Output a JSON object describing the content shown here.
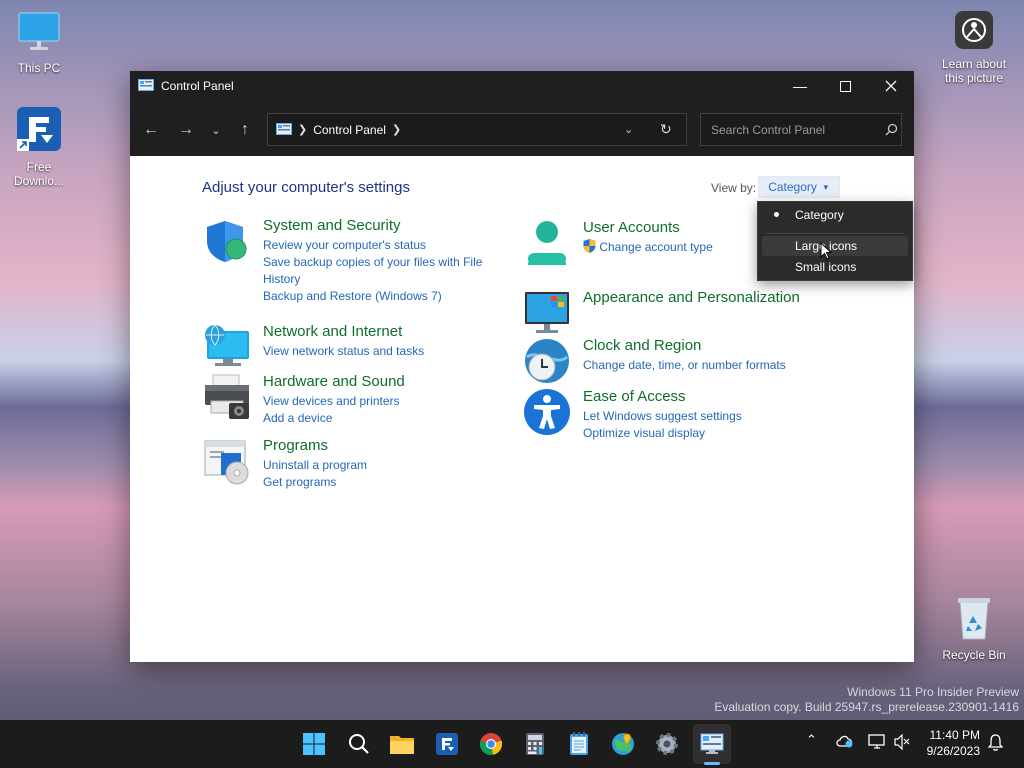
{
  "desktop": {
    "icons": [
      {
        "label": "This PC"
      },
      {
        "label": "Free Downlo..."
      },
      {
        "label": "Learn about this picture"
      },
      {
        "label": "Recycle Bin"
      }
    ],
    "watermark": {
      "line1": "Windows 11 Pro Insider Preview",
      "line2": "Evaluation copy. Build 25947.rs_prerelease.230901-1416"
    }
  },
  "window": {
    "title": "Control Panel",
    "address": {
      "path": "Control Panel"
    },
    "search": {
      "placeholder": "Search Control Panel"
    },
    "heading": "Adjust your computer's settings",
    "view_by": {
      "label": "View by:",
      "value": "Category"
    },
    "menu": {
      "items": [
        "Category",
        "Large icons",
        "Small icons"
      ],
      "selected": "Category",
      "hovered": "Large icons"
    },
    "categories": [
      {
        "title": "System and Security",
        "links": [
          "Review your computer's status",
          "Save backup copies of your files with File History",
          "Backup and Restore (Windows 7)"
        ]
      },
      {
        "title": "Network and Internet",
        "links": [
          "View network status and tasks"
        ]
      },
      {
        "title": "Hardware and Sound",
        "links": [
          "View devices and printers",
          "Add a device"
        ]
      },
      {
        "title": "Programs",
        "links": [
          "Uninstall a program",
          "Get programs"
        ]
      },
      {
        "title": "User Accounts",
        "links": [
          "Change account type"
        ]
      },
      {
        "title": "Appearance and Personalization",
        "links": []
      },
      {
        "title": "Clock and Region",
        "links": [
          "Change date, time, or number formats"
        ]
      },
      {
        "title": "Ease of Access",
        "links": [
          "Let Windows suggest settings",
          "Optimize visual display"
        ]
      }
    ]
  },
  "taskbar": {
    "apps": [
      "start-icon",
      "search-icon",
      "file-explorer-icon",
      "free-download-manager-icon",
      "chrome-icon",
      "calculator-icon",
      "notepad-icon",
      "maps-icon",
      "settings-icon",
      "control-panel-icon"
    ],
    "clock": {
      "time": "11:40 PM",
      "date": "9/26/2023"
    }
  },
  "colors": {
    "category_title": "#0f6e2b",
    "link": "#2468b8",
    "heading": "#1e3287",
    "accent": "#6ab7ff"
  }
}
